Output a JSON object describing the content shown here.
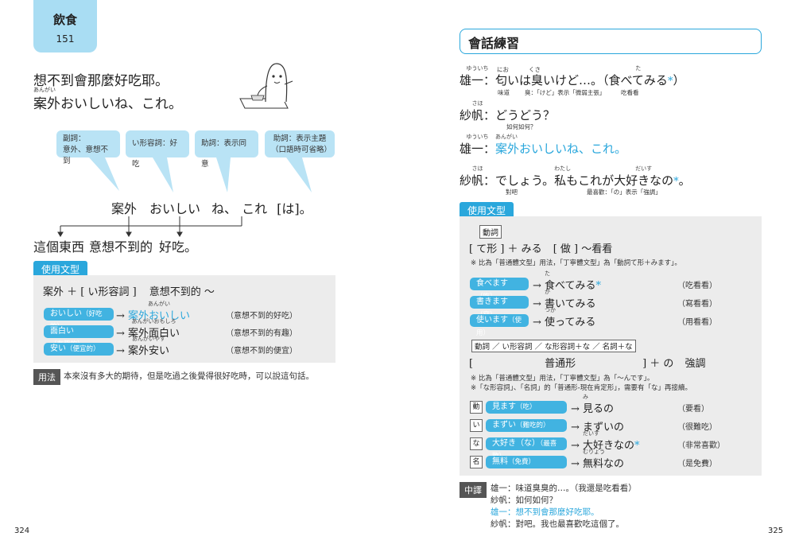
{
  "left": {
    "tab": {
      "category": "飲食",
      "number": "151"
    },
    "title_zh": "想不到會那麼好吃耶。",
    "title_jp": "案外おいしいね、これ。",
    "title_ruby": "あんがい",
    "bubbles": [
      {
        "line1": "副詞：",
        "line2": "意外、意想不到"
      },
      {
        "line1": "い形容詞：好吃",
        "line2": ""
      },
      {
        "line1": "助詞：表示同意",
        "line2": ""
      },
      {
        "line1": "助詞：表示主題",
        "line2": "（口語時可省略）"
      }
    ],
    "analysis": {
      "w1": "案外",
      "w2": "おいしい",
      "w3": "ね",
      "w4": "、",
      "w5": "これ",
      "w6": "[は]",
      "w7": "。"
    },
    "translation": {
      "t1": "這個東西",
      "t2": "意想不到的",
      "t3": "好吃",
      "t4": "。"
    },
    "grammar": {
      "tag": "使用文型",
      "pattern_a": "案外 ＋ [ い形容詞 ]",
      "pattern_b": "意想不到的 ～",
      "rows": [
        {
          "pill": "おいしい",
          "pill_note": "（好吃的）",
          "ruby": "あんがい",
          "result": "案外おいしい",
          "meaning": "（意想不到的好吃）",
          "blue": true
        },
        {
          "pill": "面白い",
          "pill_note": "（有趣的）",
          "ruby": "あんがいおもしろ",
          "result": "案外面白い",
          "meaning": "（意想不到的有趣）",
          "blue": false
        },
        {
          "pill": "安い",
          "pill_note": "（便宜的）",
          "ruby": "あんがいやす",
          "result": "案外安い",
          "meaning": "（意想不到的便宜）",
          "blue": false
        }
      ]
    },
    "usage": {
      "tag": "用法",
      "text": "本來沒有多大的期待，但是吃過之後覺得很好吃時，可以說這句話。"
    },
    "page_number": "324"
  },
  "right": {
    "title": "會話練習",
    "dialog": {
      "l1": {
        "speaker": "雄一：",
        "speaker_ruby": "ゆういち",
        "text_a": "匂いは臭いけど…。（",
        "ruby_a": "にお",
        "ruby_b": "くさ",
        "text_b": "食べてみる",
        "ruby_c": "た",
        "star": "*",
        "text_c": "）",
        "g1": "味道",
        "g2": "臭：「けど」表示「微弱主張」",
        "g3": "吃看看"
      },
      "l2": {
        "speaker": "紗帆：",
        "speaker_ruby": "さほ",
        "text": "どうどう？",
        "gloss": "如何如何？"
      },
      "l3": {
        "speaker": "雄一：",
        "speaker_ruby": "ゆういち",
        "text": "案外おいしいね、これ。",
        "ruby": "あんがい"
      },
      "l4": {
        "speaker": "紗帆：",
        "speaker_ruby": "さほ",
        "text_a": "でしょう。",
        "text_b": "私もこれが",
        "ruby_b": "わたし",
        "text_c": "大好きなの",
        "ruby_c": "だいす",
        "star": "*",
        "text_d": "。",
        "g1": "對吧",
        "g2": "最喜歡：「の」表示「強調」"
      }
    },
    "grammar": {
      "tag": "使用文型",
      "box1": {
        "label": "動詞",
        "pattern_a": "[ て形 ] ＋ みる",
        "pattern_b": "[ 做 ] ～看看",
        "note": "※ 比為「普通體文型」用法，「丁寧體文型」為「動詞て形＋みます」。",
        "rows": [
          {
            "pill": "食べます",
            "pill_note": "（吃）",
            "ruby": "た",
            "result": "食べてみる",
            "star": "*",
            "meaning": "（吃看看）"
          },
          {
            "pill": "書きます",
            "pill_note": "（寫）",
            "ruby": "か",
            "result": "書いてみる",
            "star": "",
            "meaning": "（寫看看）"
          },
          {
            "pill": "使います",
            "pill_note": "（使用）",
            "ruby": "つか",
            "result": "使ってみる",
            "star": "",
            "meaning": "（用看看）"
          }
        ]
      },
      "box2": {
        "label": "動詞 ／ い形容詞 ／ な形容詞＋な ／ 名詞＋な",
        "pattern_a": "[",
        "pattern_mid": "普通形",
        "pattern_b": "] ＋ の",
        "pattern_c": "強調",
        "note1": "※ 比為「普通體文型」用法，「丁寧體文型」為「～んです」。",
        "note2": "※「な形容詞」、「名詞」的「普通形-現在肯定形」，需要有「な」再接續。",
        "rows": [
          {
            "mark": "動",
            "pill": "見ます",
            "pill_note": "（吃）",
            "ruby": "み",
            "result": "見るの",
            "star": "",
            "meaning": "（要看）"
          },
          {
            "mark": "い",
            "pill": "まずい",
            "pill_note": "（難吃的）",
            "ruby": "",
            "result": "まずいの",
            "star": "",
            "meaning": "（很難吃）"
          },
          {
            "mark": "な",
            "pill": "大好き（な）",
            "pill_note": "（最喜歡）",
            "ruby": "だいす",
            "result": "大好きなの",
            "star": "*",
            "meaning": "（非常喜歡）"
          },
          {
            "mark": "名",
            "pill": "無料",
            "pill_note": "（免費）",
            "ruby": "むりょう",
            "result": "無料なの",
            "star": "",
            "meaning": "（是免費）"
          }
        ]
      }
    },
    "translation": {
      "tag": "中譯",
      "lines": [
        {
          "text": "雄一：味道臭臭的…。（我還是吃看看）",
          "blue": false
        },
        {
          "text": "紗帆：如何如何？",
          "blue": false
        },
        {
          "text": "雄一：想不到會那麼好吃耶。",
          "blue": true
        },
        {
          "text": "紗帆：對吧。我也最喜歡吃這個了。",
          "blue": false
        }
      ]
    },
    "page_number": "325"
  }
}
